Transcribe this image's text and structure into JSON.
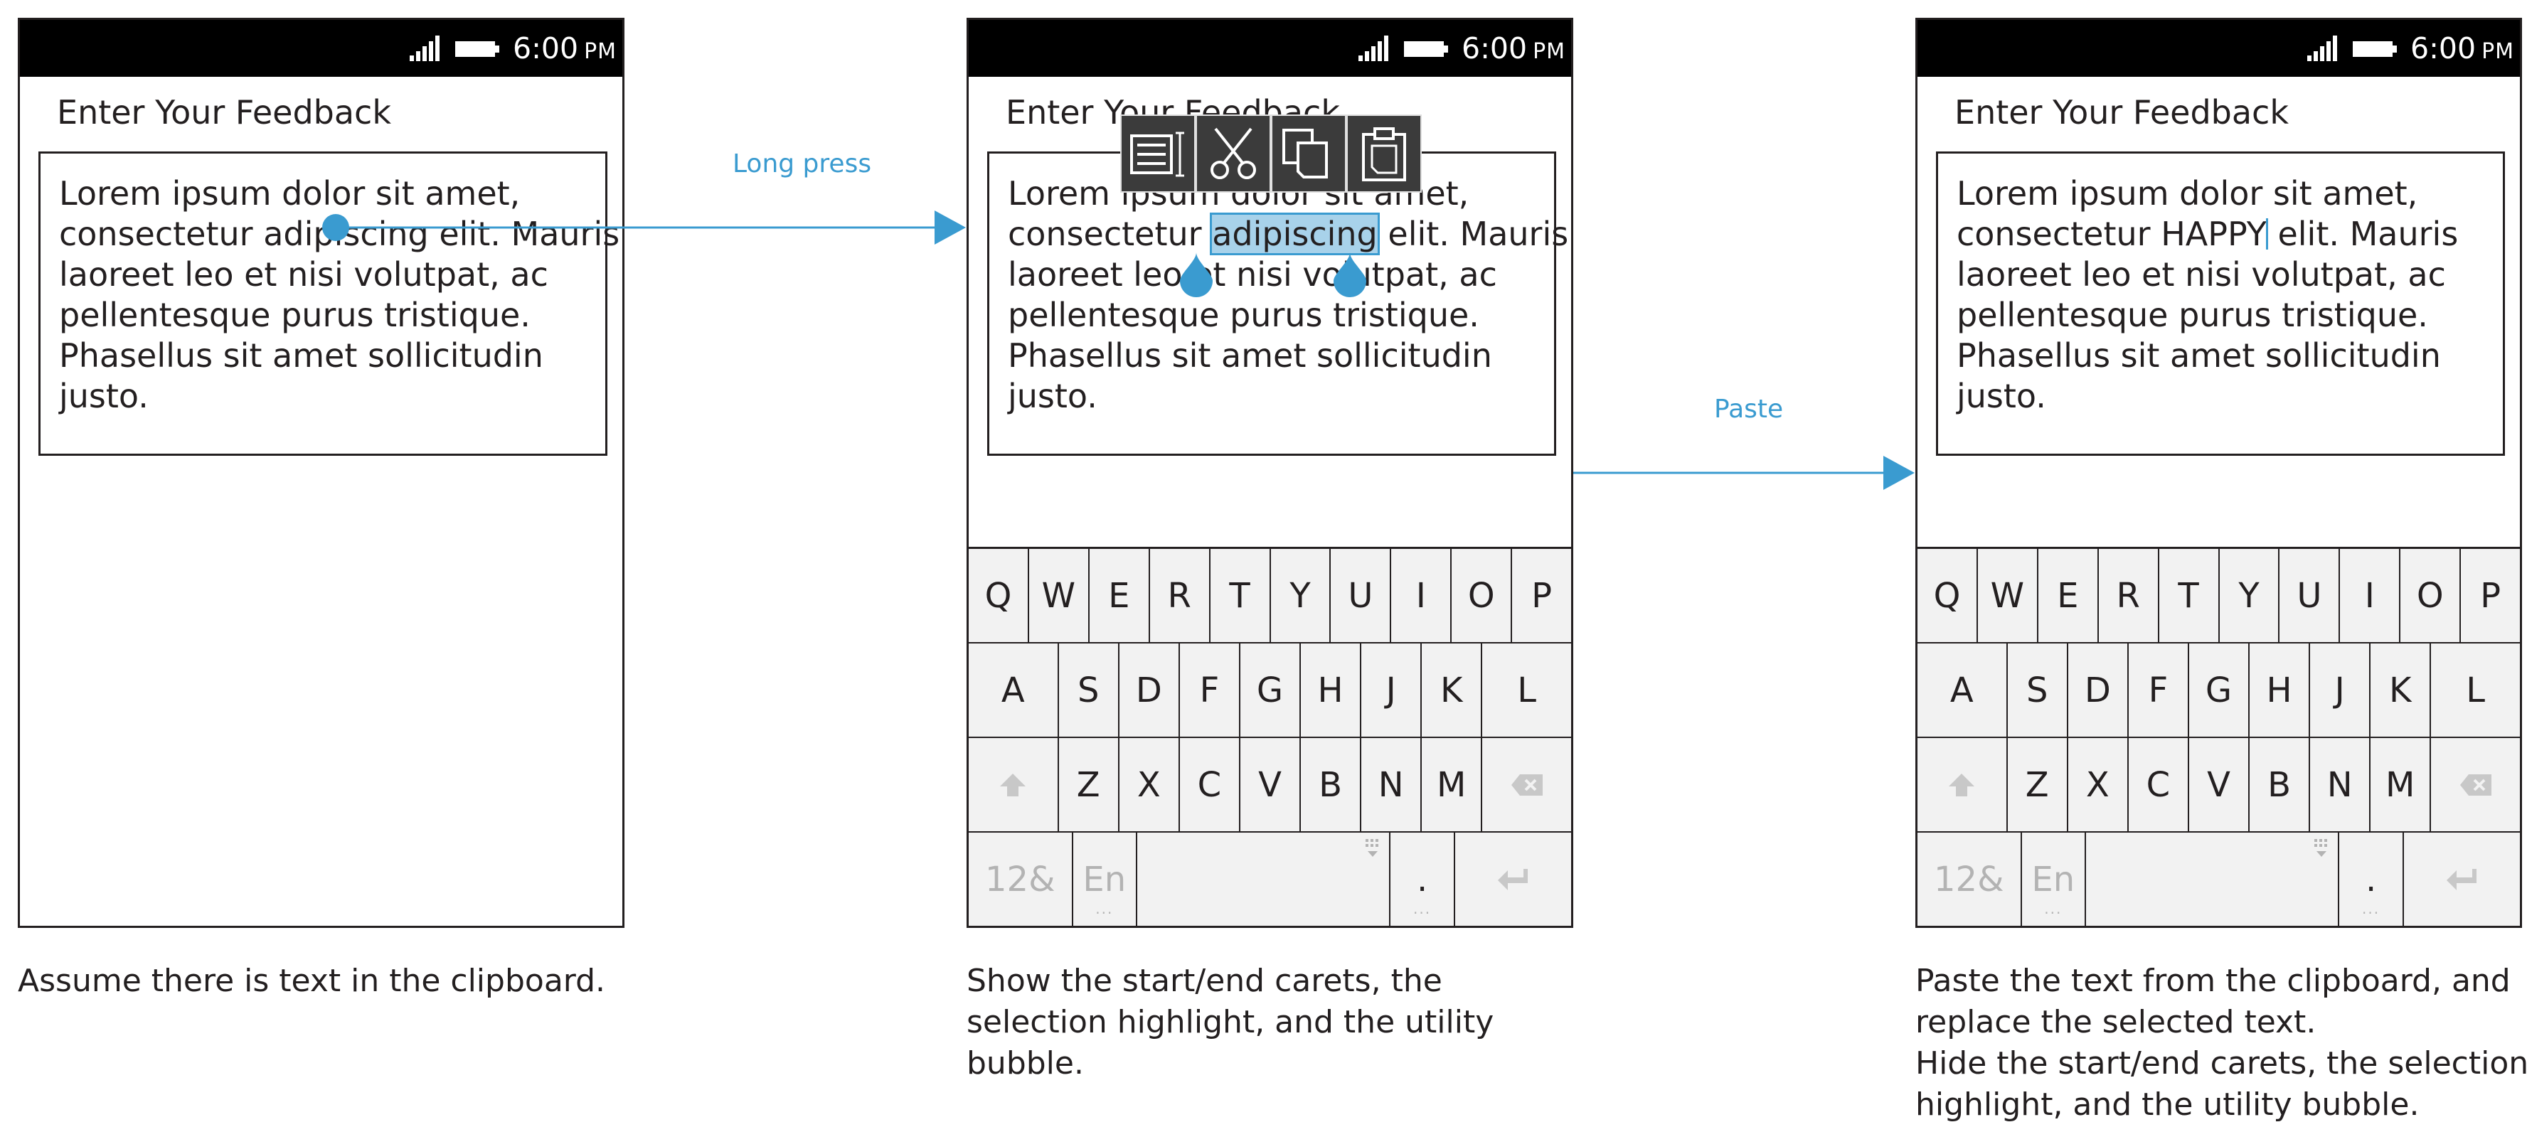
{
  "status": {
    "time": "6:00",
    "ampm": "PM"
  },
  "screen_title": "Enter Your Feedback",
  "panels": [
    {
      "lines": [
        "Lorem ipsum dolor sit amet,",
        "consectetur adipiscing elit. Mauris",
        "laoreet leo et nisi volutpat, ac",
        "pellentesque purus tristique.",
        "Phasellus sit amet sollicitudin",
        "justo."
      ],
      "caption": [
        "Assume there is text in the clipboard."
      ]
    },
    {
      "lines": [
        "Lorem ipsum dolor sit amet,",
        "consectetur ",
        "adipiscing",
        " elit. Mauris",
        "laoreet leo et nisi volutpat, ac",
        "pellentesque purus tristique.",
        "Phasellus sit amet sollicitudin",
        "justo."
      ],
      "caption": [
        "Show the start/end carets, the",
        "selection highlight, and the utility",
        "bubble."
      ]
    },
    {
      "lines": [
        "Lorem ipsum dolor sit amet,",
        "consectetur HAPPY",
        " elit. Mauris",
        "laoreet leo et nisi volutpat, ac",
        "pellentesque purus tristique.",
        "Phasellus sit amet sollicitudin",
        "justo."
      ],
      "caption": [
        "Paste the text from the clipboard, and",
        "replace the selected text.",
        "Hide the start/end carets, the selection",
        "highlight, and the utility bubble."
      ]
    }
  ],
  "arrows": {
    "long_press": "Long press",
    "paste": "Paste"
  },
  "keyboard": {
    "row1": [
      "Q",
      "W",
      "E",
      "R",
      "T",
      "Y",
      "U",
      "I",
      "O",
      "P"
    ],
    "row2": [
      "A",
      "S",
      "D",
      "F",
      "G",
      "H",
      "J",
      "K",
      "L"
    ],
    "row3": [
      "Z",
      "X",
      "C",
      "V",
      "B",
      "N",
      "M"
    ],
    "numbers": "12&",
    "lang": "En",
    "period": ".",
    "dots": "···"
  },
  "bubble_icons": [
    "select-all-icon",
    "cut-icon",
    "copy-icon",
    "paste-icon"
  ],
  "colors": {
    "accent": "#3a9bd0",
    "selection": "#a8d2ea",
    "status_bar": "#000000",
    "keyboard_bg": "#f2f2f2"
  }
}
